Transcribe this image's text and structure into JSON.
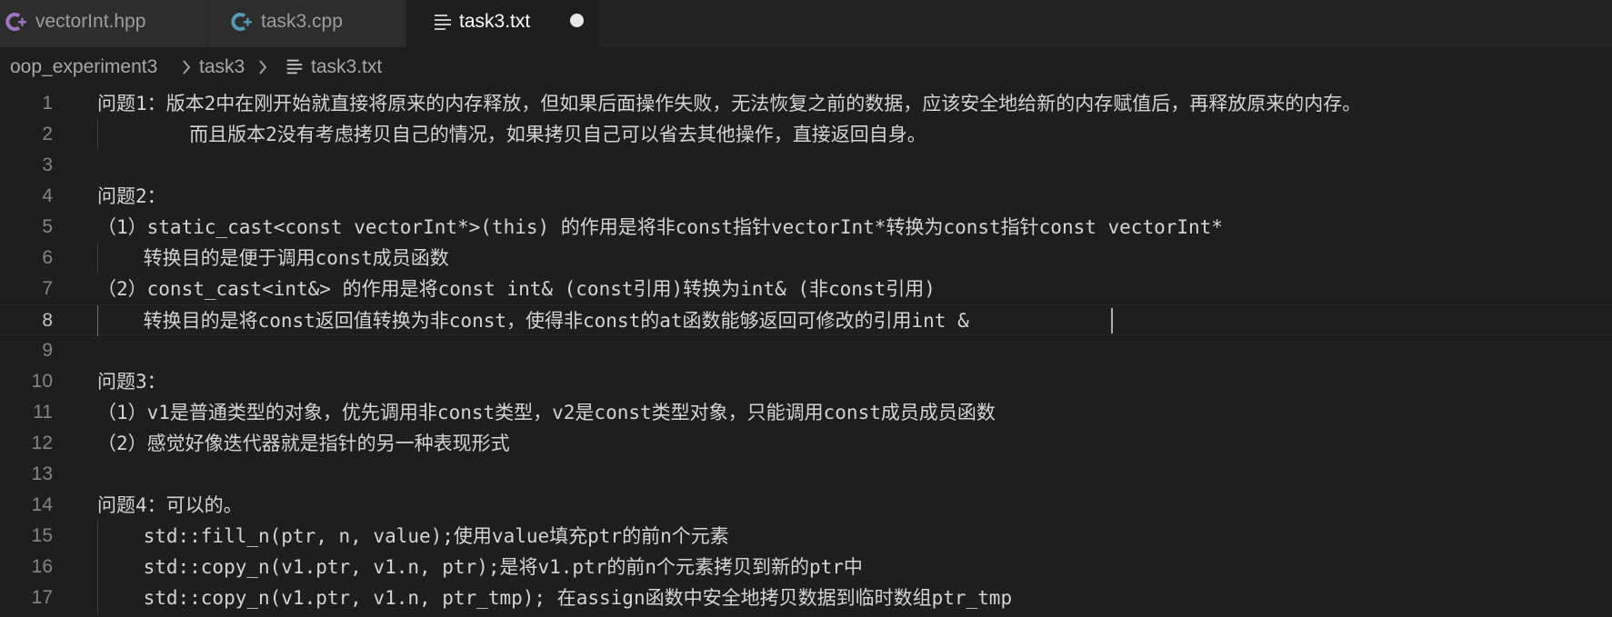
{
  "tabs": [
    {
      "label": "vectorInt.hpp",
      "icon": "cpp-header-icon",
      "active": false
    },
    {
      "label": "task3.cpp",
      "icon": "cpp-file-icon",
      "active": false
    },
    {
      "label": "task3.txt",
      "icon": "text-file-icon",
      "active": true,
      "dirty": true
    }
  ],
  "breadcrumb": [
    "oop_experiment3",
    "task3",
    "task3.txt"
  ],
  "editor": {
    "current_line": 8,
    "lines": [
      {
        "num": "1",
        "text": "问题1：版本2中在刚开始就直接将原来的内存释放，但如果后面操作失败，无法恢复之前的数据，应该安全地给新的内存赋值后，再释放原来的内存。"
      },
      {
        "num": "2",
        "text": "        而且版本2没有考虑拷贝自己的情况，如果拷贝自己可以省去其他操作，直接返回自身。"
      },
      {
        "num": "3",
        "text": ""
      },
      {
        "num": "4",
        "text": "问题2："
      },
      {
        "num": "5",
        "text": "（1）static_cast<const vectorInt*>(this) 的作用是将非const指针vectorInt*转换为const指针const vectorInt*"
      },
      {
        "num": "6",
        "text": "    转换目的是便于调用const成员函数"
      },
      {
        "num": "7",
        "text": "（2）const_cast<int&> 的作用是将const int& (const引用)转换为int& (非const引用)"
      },
      {
        "num": "8",
        "text": "    转换目的是将const返回值转换为非const，使得非const的at函数能够返回可修改的引用int &"
      },
      {
        "num": "9",
        "text": ""
      },
      {
        "num": "10",
        "text": "问题3："
      },
      {
        "num": "11",
        "text": "（1）v1是普通类型的对象，优先调用非const类型，v2是const类型对象，只能调用const成员成员函数"
      },
      {
        "num": "12",
        "text": "（2）感觉好像迭代器就是指针的另一种表现形式"
      },
      {
        "num": "13",
        "text": ""
      },
      {
        "num": "14",
        "text": "问题4：可以的。"
      },
      {
        "num": "15",
        "text": "    std::fill_n(ptr, n, value);使用value填充ptr的前n个元素"
      },
      {
        "num": "16",
        "text": "    std::copy_n(v1.ptr, v1.n, ptr);是将v1.ptr的前n个元素拷贝到新的ptr中"
      },
      {
        "num": "17",
        "text": "    std::copy_n(v1.ptr, v1.n, ptr_tmp); 在assign函数中安全地拷贝数据到临时数组ptr_tmp"
      }
    ]
  },
  "colors": {
    "editor_bg": "#1e1e1e",
    "tabbar_bg": "#252526",
    "inactive_tab_bg": "#2d2d2d",
    "cpp_icon": "#a074c4",
    "text_icon": "#c5c5c5"
  }
}
